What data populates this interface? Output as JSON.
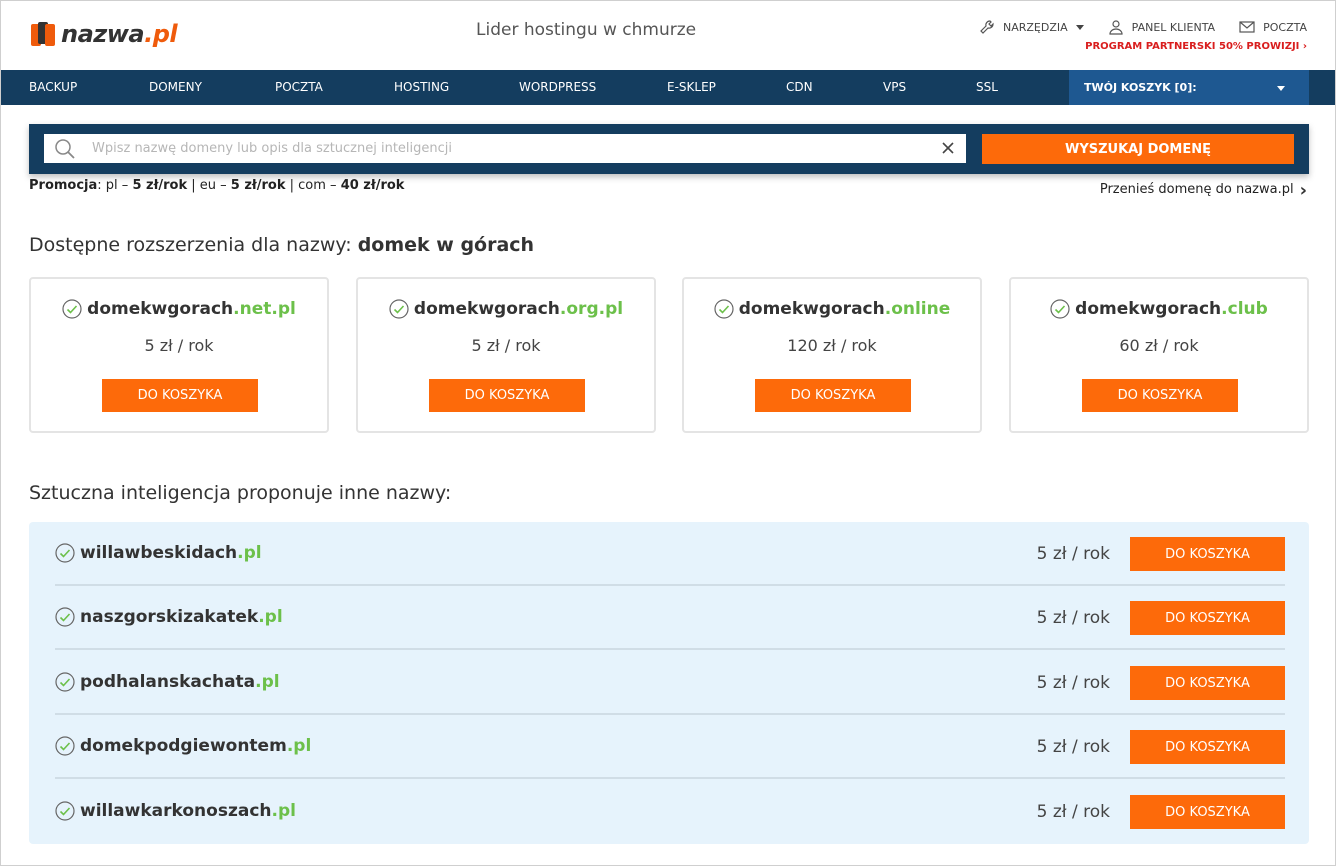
{
  "header": {
    "logo_text": "nazwa",
    "logo_tld": ".pl",
    "tagline": "Lider hostingu w chmurze",
    "tools_label": "NARZĘDZIA",
    "panel_label": "PANEL KLIENTA",
    "mail_label": "POCZTA",
    "partner_label": "PROGRAM PARTNERSKI 50% PROWIZJI ›"
  },
  "nav": {
    "items": [
      "BACKUP",
      "DOMENY",
      "POCZTA",
      "HOSTING",
      "WORDPRESS",
      "E-SKLEP",
      "CDN",
      "VPS",
      "SSL"
    ],
    "cart_label": "TWÓJ KOSZYK [0]:"
  },
  "search": {
    "placeholder": "Wpisz nazwę domeny lub opis dla sztucznej inteligencji",
    "button_label": "WYSZUKAJ DOMENĘ"
  },
  "promo": {
    "label": "Promocja",
    "pl_price": "5 zł/rok",
    "eu_price": "5 zł/rok",
    "com_price": "40 zł/rok"
  },
  "transfer_label": "Przenieś domenę do nazwa.pl",
  "available": {
    "title_prefix": "Dostępne rozszerzenia dla nazwy:",
    "query": "domek w górach",
    "cards": [
      {
        "name": "domekwgorach",
        "tld": ".net.pl",
        "price": "5 zł / rok",
        "button": "DO KOSZYKA"
      },
      {
        "name": "domekwgorach",
        "tld": ".org.pl",
        "price": "5 zł / rok",
        "button": "DO KOSZYKA"
      },
      {
        "name": "domekwgorach",
        "tld": ".online",
        "price": "120 zł / rok",
        "button": "DO KOSZYKA"
      },
      {
        "name": "domekwgorach",
        "tld": ".club",
        "price": "60 zł / rok",
        "button": "DO KOSZYKA"
      }
    ]
  },
  "ai": {
    "title": "Sztuczna inteligencja proponuje inne nazwy:",
    "rows": [
      {
        "name": "willawbeskidach",
        "tld": ".pl",
        "price": "5 zł / rok",
        "button": "DO KOSZYKA"
      },
      {
        "name": "naszgorskizakatek",
        "tld": ".pl",
        "price": "5 zł / rok",
        "button": "DO KOSZYKA"
      },
      {
        "name": "podhalanskachata",
        "tld": ".pl",
        "price": "5 zł / rok",
        "button": "DO KOSZYKA"
      },
      {
        "name": "domekpodgiewontem",
        "tld": ".pl",
        "price": "5 zł / rok",
        "button": "DO KOSZYKA"
      },
      {
        "name": "willawkarkonoszach",
        "tld": ".pl",
        "price": "5 zł / rok",
        "button": "DO KOSZYKA"
      }
    ]
  },
  "colors": {
    "navy": "#143d5f",
    "cart_blue": "#1e5891",
    "orange": "#fd6a0a",
    "green": "#6cc04a",
    "partner_red": "#d91e1e"
  }
}
